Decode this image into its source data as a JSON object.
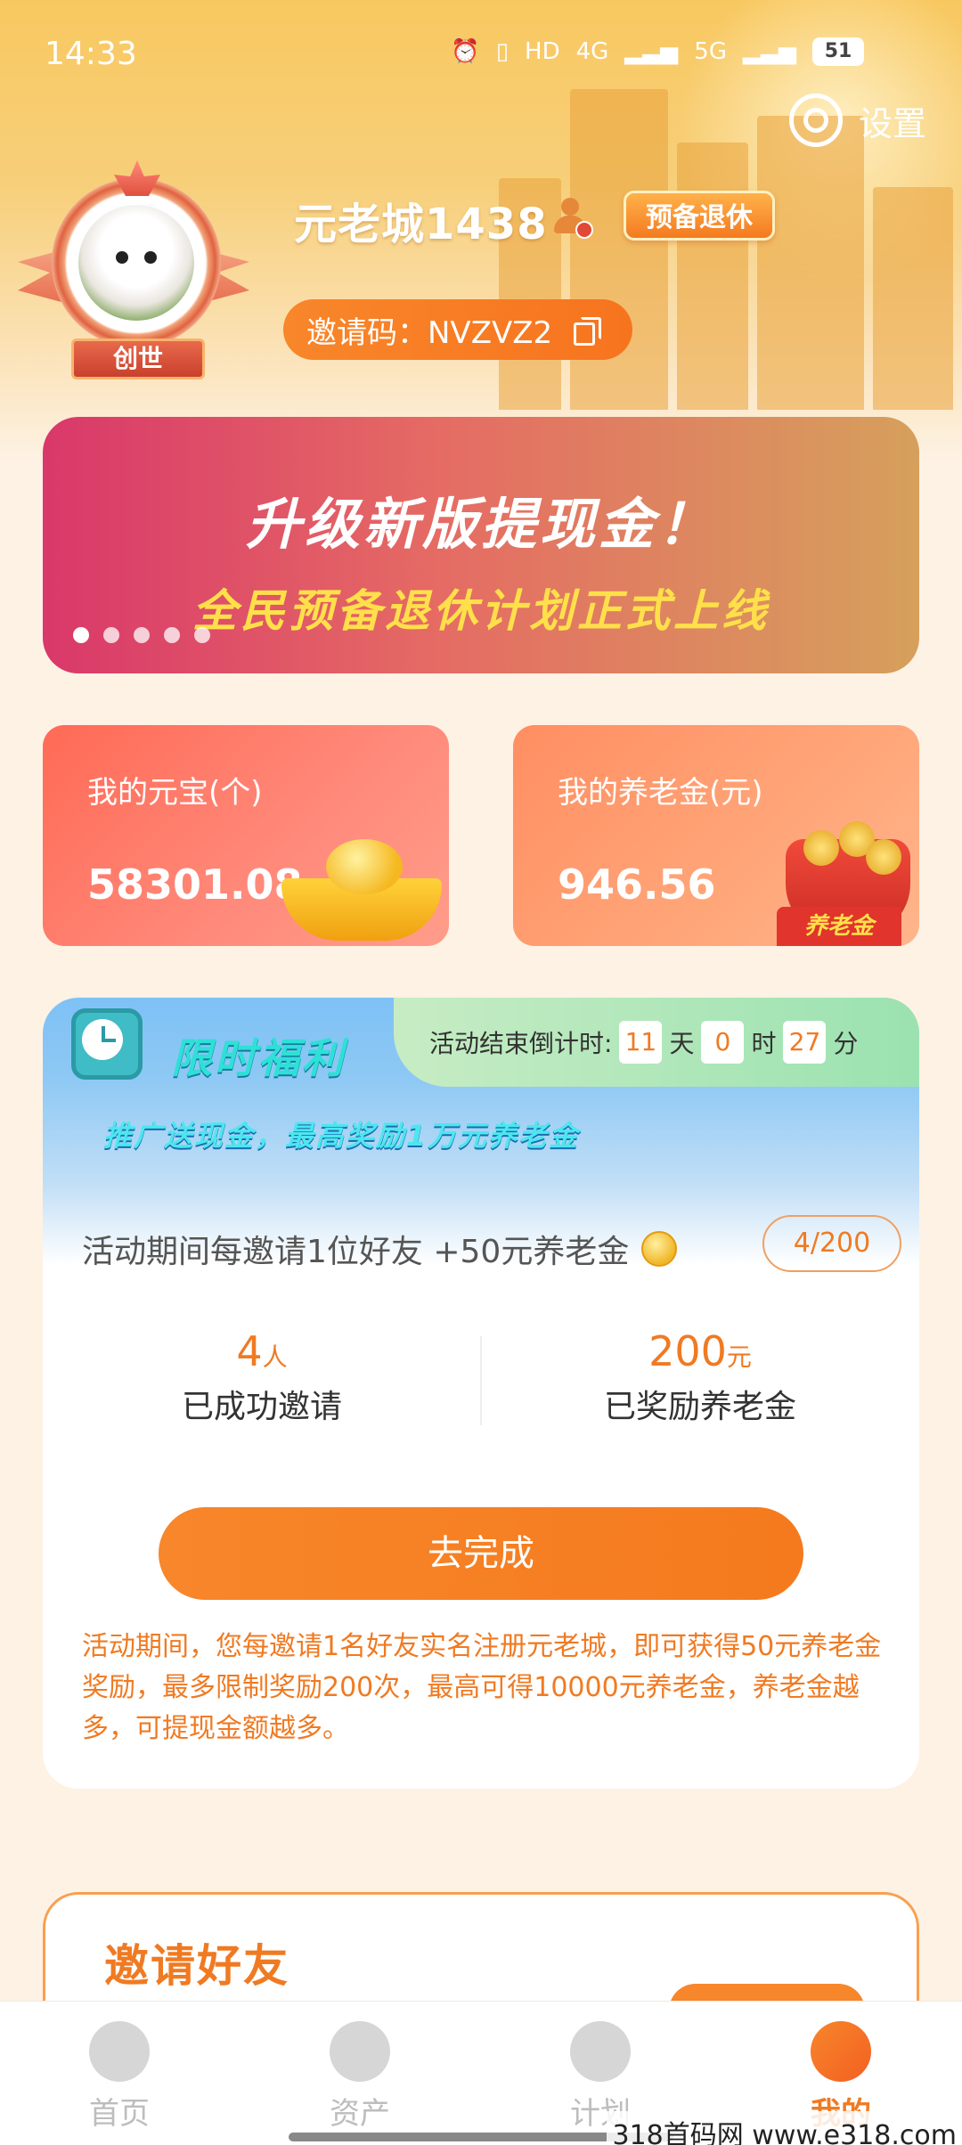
{
  "status_bar": {
    "time": "14:33",
    "network_1": "4G",
    "network_2": "5G",
    "battery": "51"
  },
  "header": {
    "settings_label": "设置",
    "username": "元老城1438",
    "retire_tag": "预备退休",
    "avatar_badge": "创世",
    "invite_code": "邀请码：NVZVZ2"
  },
  "banner": {
    "title": "升级新版提现金！",
    "subtitle": "全民预备退休计划正式上线",
    "page_count": 5,
    "active_index": 0
  },
  "cards": {
    "yuanbao_label": "我的元宝(个)",
    "yuanbao_value": "58301.08",
    "pension_label": "我的养老金(元)",
    "pension_value": "946.56",
    "pension_bag_label": "养老金"
  },
  "welfare": {
    "title": "限时福利",
    "countdown_label": "活动结束倒计时:",
    "days": "11",
    "days_unit": "天",
    "hours": "0",
    "hours_unit": "时",
    "minutes": "27",
    "minutes_unit": "分",
    "subtitle": "推广送现金，最高奖励1万元养老金",
    "rule": "活动期间每邀请1位好友 +50元养老金",
    "progress": "4/200",
    "invited_count": "4",
    "invited_unit": "人",
    "invited_desc": "已成功邀请",
    "reward_amount": "200",
    "reward_unit": "元",
    "reward_desc": "已奖励养老金",
    "button": "去完成",
    "note": "活动期间，您每邀请1名好友实名注册元老城，即可获得50元养老金奖励，最多限制奖励200次，最高可得10000元养老金，养老金越多，可提现金额越多。"
  },
  "invite_section": {
    "title": "邀请好友"
  },
  "tabbar": {
    "items": [
      {
        "label": "首页"
      },
      {
        "label": "资产"
      },
      {
        "label": "计划"
      },
      {
        "label": "我的"
      }
    ],
    "active": "我的"
  },
  "watermark": "318首码网  www.e318.com"
}
